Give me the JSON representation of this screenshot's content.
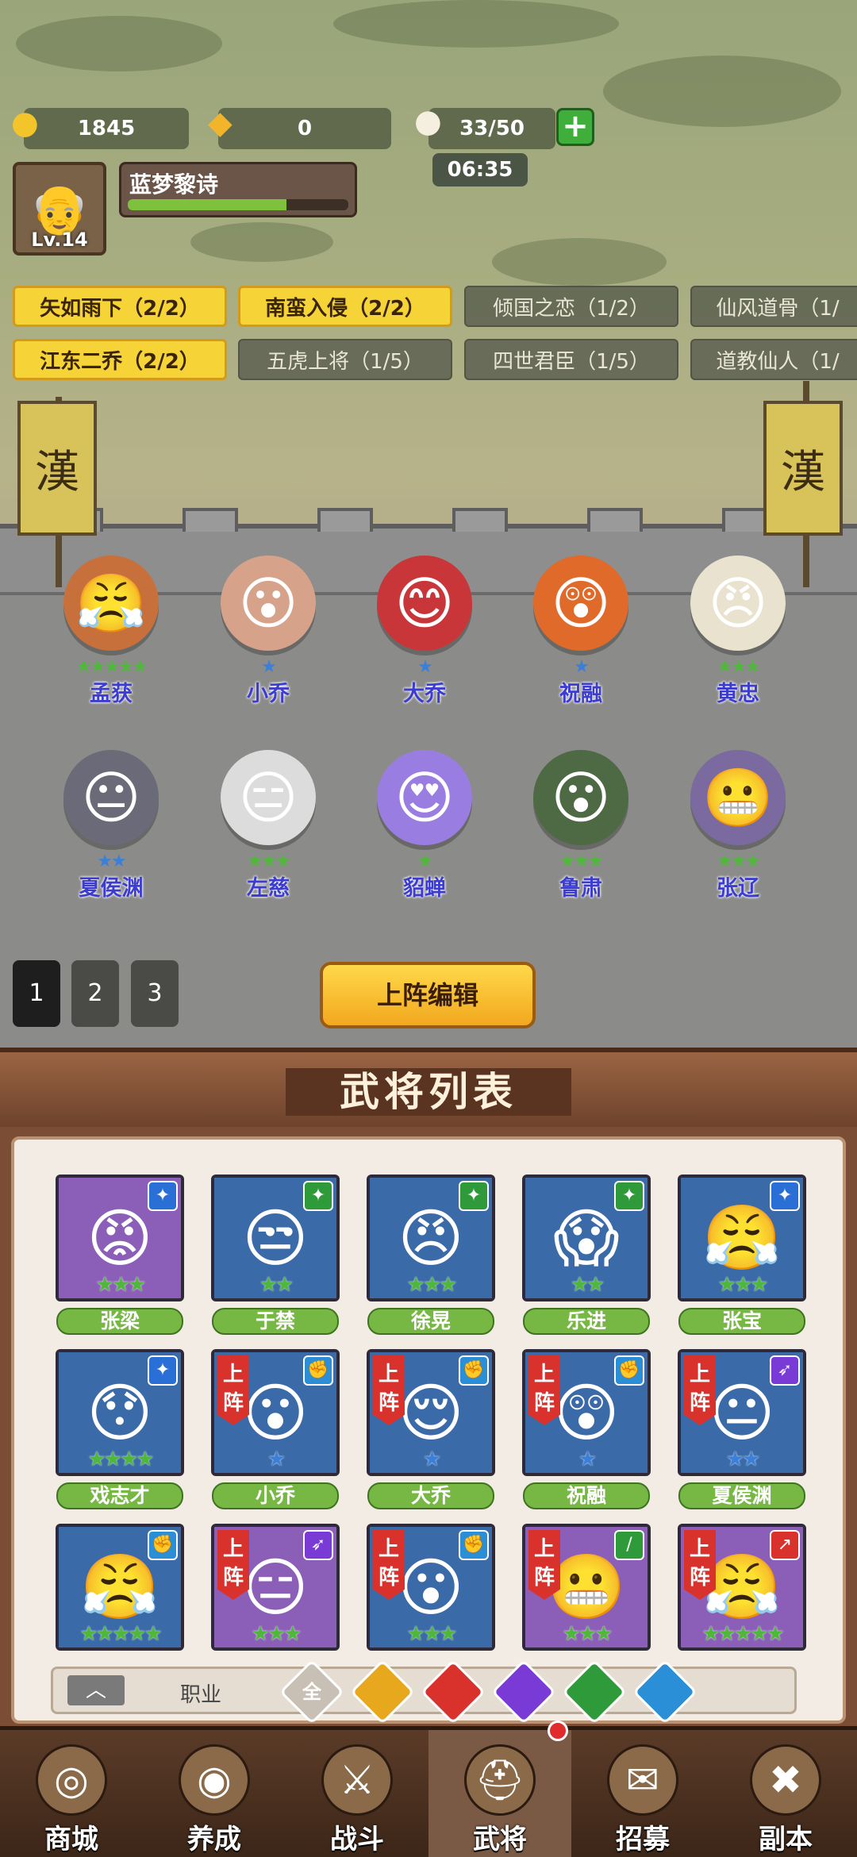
{
  "resources": {
    "gold": "1845",
    "ticket": "0",
    "stamina": "33/50",
    "timer": "06:35",
    "gold_icon": "gold-ingot-icon",
    "ticket_icon": "ticket-icon",
    "stamina_icon": "bun-icon",
    "add_icon": "plus-icon"
  },
  "player": {
    "name": "蓝梦黎诗",
    "level": "Lv.14",
    "xp_fraction": 0.72
  },
  "bonds": [
    {
      "label": "矢如雨下（2/2）",
      "active": true
    },
    {
      "label": "南蛮入侵（2/2）",
      "active": true
    },
    {
      "label": "倾国之恋（1/2）",
      "active": false
    },
    {
      "label": "仙风道骨（1/",
      "active": false
    },
    {
      "label": "江东二乔（2/2）",
      "active": true
    },
    {
      "label": "五虎上将（1/5）",
      "active": false
    },
    {
      "label": "四世君臣（1/5）",
      "active": false
    },
    {
      "label": "道教仙人（1/",
      "active": false
    }
  ],
  "banner_glyph": "漢",
  "formation": [
    {
      "name": "孟获",
      "stars": "★★★★★",
      "star_color": "#4fb83a",
      "emoji": "😤",
      "color": "#c8703c"
    },
    {
      "name": "小乔",
      "stars": "★",
      "star_color": "#3a7fd9",
      "emoji": "😮",
      "color": "#d7a28a"
    },
    {
      "name": "大乔",
      "stars": "★",
      "star_color": "#3a7fd9",
      "emoji": "😊",
      "color": "#c9363a"
    },
    {
      "name": "祝融",
      "stars": "★",
      "star_color": "#3a7fd9",
      "emoji": "😲",
      "color": "#e06a2a"
    },
    {
      "name": "黄忠",
      "stars": "★★★",
      "star_color": "#4fb83a",
      "emoji": "😠",
      "color": "#e8e2cf"
    },
    {
      "name": "夏侯渊",
      "stars": "★★",
      "star_color": "#3a7fd9",
      "emoji": "😐",
      "color": "#6a6a78"
    },
    {
      "name": "左慈",
      "stars": "★★★",
      "star_color": "#4fb83a",
      "emoji": "😑",
      "color": "#dcdcdc"
    },
    {
      "name": "貂蝉",
      "stars": "★",
      "star_color": "#4fb83a",
      "emoji": "😍",
      "color": "#9a7de0"
    },
    {
      "name": "鲁肃",
      "stars": "★★★",
      "star_color": "#4fb83a",
      "emoji": "😮",
      "color": "#4e6a44"
    },
    {
      "name": "张辽",
      "stars": "★★★",
      "star_color": "#4fb83a",
      "emoji": "😬",
      "color": "#7a6aa0"
    }
  ],
  "pages": [
    "1",
    "2",
    "3"
  ],
  "edit_button": "上阵编辑",
  "roster_title": "武将列表",
  "deploy_tag": "上阵",
  "roster": [
    {
      "name": "张梁",
      "stars": "★★★",
      "star_color": "#4fb83a",
      "class_color": "#2a6fd6",
      "class_icon": "magic-icon",
      "bg": "#8b5fb8",
      "emoji": "😡",
      "deployed": false
    },
    {
      "name": "于禁",
      "stars": "★★",
      "star_color": "#4fb83a",
      "class_color": "#2f9a3a",
      "class_icon": "magic-icon",
      "bg": "#3a6aa8",
      "emoji": "😒",
      "deployed": false
    },
    {
      "name": "徐晃",
      "stars": "★★★",
      "star_color": "#4fb83a",
      "class_color": "#2f9a3a",
      "class_icon": "magic-icon",
      "bg": "#3a6aa8",
      "emoji": "😠",
      "deployed": false
    },
    {
      "name": "乐进",
      "stars": "★★",
      "star_color": "#4fb83a",
      "class_color": "#2f9a3a",
      "class_icon": "magic-icon",
      "bg": "#3a6aa8",
      "emoji": "😱",
      "deployed": false
    },
    {
      "name": "张宝",
      "stars": "★★★",
      "star_color": "#4fb83a",
      "class_color": "#2a6fd6",
      "class_icon": "magic-icon",
      "bg": "#3a6aa8",
      "emoji": "😤",
      "deployed": false
    },
    {
      "name": "戏志才",
      "stars": "★★★★",
      "star_color": "#4fb83a",
      "class_color": "#2a6fd6",
      "class_icon": "magic-icon",
      "bg": "#3a6aa8",
      "emoji": "😯",
      "deployed": false
    },
    {
      "name": "小乔",
      "stars": "★",
      "star_color": "#3a7fd9",
      "class_color": "#2a8fd6",
      "class_icon": "fist-icon",
      "bg": "#3a6aa8",
      "emoji": "😮",
      "deployed": true
    },
    {
      "name": "大乔",
      "stars": "★",
      "star_color": "#3a7fd9",
      "class_color": "#2a8fd6",
      "class_icon": "fist-icon",
      "bg": "#3a6aa8",
      "emoji": "😌",
      "deployed": true
    },
    {
      "name": "祝融",
      "stars": "★",
      "star_color": "#3a7fd9",
      "class_color": "#2a8fd6",
      "class_icon": "fist-icon",
      "bg": "#3a6aa8",
      "emoji": "😲",
      "deployed": true
    },
    {
      "name": "夏侯渊",
      "stars": "★★",
      "star_color": "#3a7fd9",
      "class_color": "#7a3ad6",
      "class_icon": "bow-icon",
      "bg": "#3a6aa8",
      "emoji": "😐",
      "deployed": true
    },
    {
      "name": "",
      "stars": "★★★★★",
      "star_color": "#4fb83a",
      "class_color": "#2a8fd6",
      "class_icon": "fist-icon",
      "bg": "#3a6aa8",
      "emoji": "😤",
      "deployed": false
    },
    {
      "name": "",
      "stars": "★★★",
      "star_color": "#4fb83a",
      "class_color": "#7a3ad6",
      "class_icon": "bow-icon",
      "bg": "#8b5fb8",
      "emoji": "😑",
      "deployed": true
    },
    {
      "name": "",
      "stars": "★★★",
      "star_color": "#4fb83a",
      "class_color": "#2a8fd6",
      "class_icon": "fist-icon",
      "bg": "#3a6aa8",
      "emoji": "😮",
      "deployed": true
    },
    {
      "name": "",
      "stars": "★★★",
      "star_color": "#4fb83a",
      "class_color": "#2f9a3a",
      "class_icon": "sword-icon",
      "bg": "#8b5fb8",
      "emoji": "😬",
      "deployed": true
    },
    {
      "name": "",
      "stars": "★★★★★",
      "star_color": "#4fb83a",
      "class_color": "#d9322c",
      "class_icon": "spear-icon",
      "bg": "#8b5fb8",
      "emoji": "😤",
      "deployed": true
    }
  ],
  "filter": {
    "label": "职业",
    "toggle_icon": "chevron-up-icon",
    "chips": [
      {
        "icon": "all-icon",
        "text": "全",
        "color": "#c8c0b4"
      },
      {
        "icon": "spear-icon",
        "text": "",
        "color": "#e8a81e"
      },
      {
        "icon": "spear-icon",
        "text": "",
        "color": "#d9322c"
      },
      {
        "icon": "bow-icon",
        "text": "",
        "color": "#7a3ad6"
      },
      {
        "icon": "sword-icon",
        "text": "",
        "color": "#2f9a3a"
      },
      {
        "icon": "fist-icon",
        "text": "",
        "color": "#2a8fd6"
      }
    ]
  },
  "nav": [
    {
      "label": "商城",
      "icon": "coin-icon",
      "glyph": "◎",
      "active": false
    },
    {
      "label": "养成",
      "icon": "scroll-icon",
      "glyph": "◉",
      "active": false
    },
    {
      "label": "战斗",
      "icon": "crossed-swords-icon",
      "glyph": "⚔",
      "active": false
    },
    {
      "label": "武将",
      "icon": "helmet-icon",
      "glyph": "⛑",
      "active": true
    },
    {
      "label": "招募",
      "icon": "recruit-icon",
      "glyph": "✉",
      "active": false
    },
    {
      "label": "副本",
      "icon": "map-icon",
      "glyph": "✖",
      "active": false
    }
  ]
}
